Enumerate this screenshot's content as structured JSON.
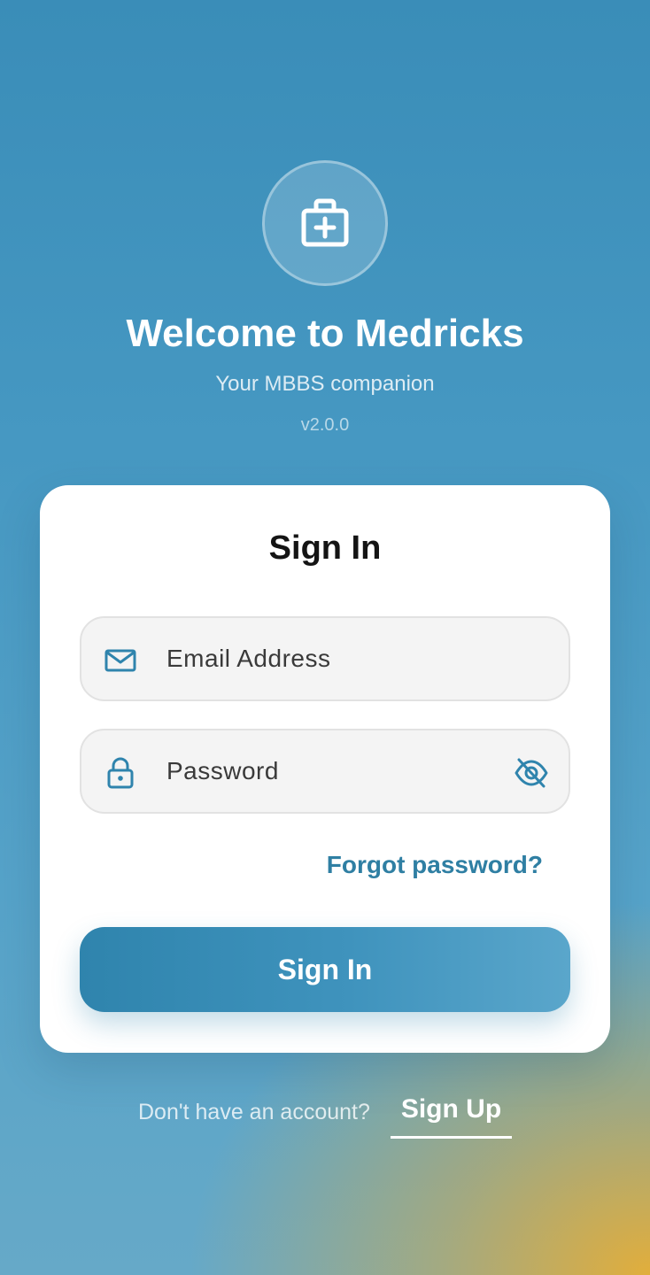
{
  "header": {
    "logo_icon": "medical-briefcase-icon",
    "title": "Welcome to Medricks",
    "subtitle": "Your MBBS companion",
    "version": "v2.0.0"
  },
  "form": {
    "title": "Sign In",
    "email": {
      "placeholder": "Email Address",
      "value": "",
      "icon": "mail-icon"
    },
    "password": {
      "placeholder": "Password",
      "value": "",
      "icon": "lock-icon",
      "toggle_icon": "eye-off-icon"
    },
    "forgot_label": "Forgot password?",
    "submit_label": "Sign In"
  },
  "footer": {
    "prompt": "Don't have an account?",
    "signup_label": "Sign Up"
  },
  "colors": {
    "accent": "#2f84ad",
    "link": "#2f7fa3",
    "background_top": "#3a8db8",
    "background_corner": "#e8ae34"
  }
}
